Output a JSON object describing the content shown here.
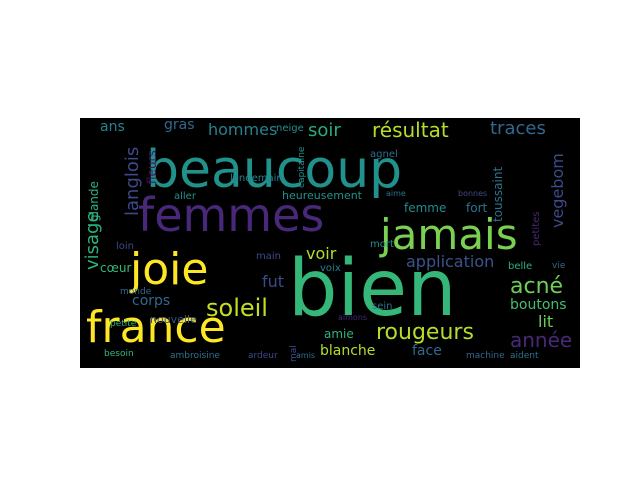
{
  "wordcloud": {
    "background": "#000000",
    "words": [
      {
        "text": "beaucoup",
        "color": "#21918c"
      },
      {
        "text": "bien",
        "color": "#35b779"
      },
      {
        "text": "femmes",
        "color": "#482878"
      },
      {
        "text": "jamais",
        "color": "#7ad151"
      },
      {
        "text": "joie",
        "color": "#fde725"
      },
      {
        "text": "france",
        "color": "#fde725"
      },
      {
        "text": "rougeurs",
        "color": "#b5de2b"
      },
      {
        "text": "soleil",
        "color": "#c2df23"
      },
      {
        "text": "acné",
        "color": "#6ece58"
      },
      {
        "text": "année",
        "color": "#482878"
      },
      {
        "text": "résultat",
        "color": "#b5de2b"
      },
      {
        "text": "traces",
        "color": "#31688e"
      },
      {
        "text": "visage",
        "color": "#2db27d"
      },
      {
        "text": "langlois",
        "color": "#3e4989"
      },
      {
        "text": "vegebom",
        "color": "#3e4989"
      },
      {
        "text": "toussaint",
        "color": "#2c728e"
      },
      {
        "text": "hommes",
        "color": "#26828e"
      },
      {
        "text": "application",
        "color": "#3b528b"
      },
      {
        "text": "boutons",
        "color": "#44bf70"
      },
      {
        "text": "soir",
        "color": "#27ad81"
      },
      {
        "text": "voir",
        "color": "#b5de2b"
      },
      {
        "text": "corps",
        "color": "#31688e"
      },
      {
        "text": "fut",
        "color": "#3e4989"
      },
      {
        "text": "lit",
        "color": "#6ece58"
      },
      {
        "text": "face",
        "color": "#31688e"
      },
      {
        "text": "blanche",
        "color": "#b5de2b"
      },
      {
        "text": "amie",
        "color": "#2db27d"
      },
      {
        "text": "femme",
        "color": "#228b8d"
      },
      {
        "text": "fort",
        "color": "#2c728e"
      },
      {
        "text": "gras",
        "color": "#31688e"
      },
      {
        "text": "ans",
        "color": "#26828e"
      },
      {
        "text": "fleurs",
        "color": "#471164"
      },
      {
        "text": "glande",
        "color": "#2db27d"
      },
      {
        "text": "cœur",
        "color": "#35b779"
      },
      {
        "text": "nouvelle",
        "color": "#3b528b"
      },
      {
        "text": "petites",
        "color": "#482878"
      },
      {
        "text": "belle",
        "color": "#2db27d"
      },
      {
        "text": "sein",
        "color": "#2c728e"
      },
      {
        "text": "voix",
        "color": "#26828e"
      },
      {
        "text": "mort",
        "color": "#21918c"
      },
      {
        "text": "neige",
        "color": "#21918c"
      },
      {
        "text": "capitaine",
        "color": "#21918c"
      },
      {
        "text": "heureusement",
        "color": "#21918c"
      },
      {
        "text": "lendemain",
        "color": "#26828e"
      },
      {
        "text": "aller",
        "color": "#21918c"
      },
      {
        "text": "agnel",
        "color": "#2c728e"
      },
      {
        "text": "main",
        "color": "#3e4989"
      },
      {
        "text": "loin",
        "color": "#3e4989"
      },
      {
        "text": "monde",
        "color": "#31688e"
      },
      {
        "text": "petite",
        "color": "#2db27d"
      },
      {
        "text": "besoin",
        "color": "#35b779"
      },
      {
        "text": "ambroisine",
        "color": "#2c728e"
      },
      {
        "text": "ardeur",
        "color": "#3e4989"
      },
      {
        "text": "mal",
        "color": "#3e4989"
      },
      {
        "text": "amis",
        "color": "#2c728e"
      },
      {
        "text": "aimons",
        "color": "#482878"
      },
      {
        "text": "machine",
        "color": "#31688e"
      },
      {
        "text": "aident",
        "color": "#2c728e"
      },
      {
        "text": "vie",
        "color": "#31688e"
      },
      {
        "text": "aime",
        "color": "#2c728e"
      },
      {
        "text": "bonnes",
        "color": "#3e4989"
      }
    ]
  }
}
